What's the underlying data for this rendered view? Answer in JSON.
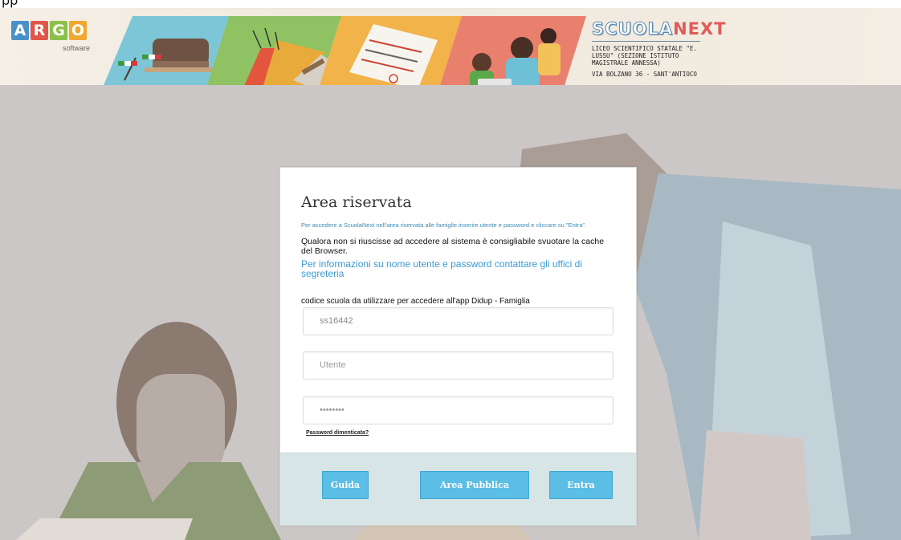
{
  "top_cut_text": "pp",
  "header": {
    "logo_letters": [
      {
        "char": "A",
        "color": "#4a90c8"
      },
      {
        "char": "R",
        "color": "#e0564a"
      },
      {
        "char": "G",
        "color": "#8cc04a"
      },
      {
        "char": "O",
        "color": "#f0a830"
      }
    ],
    "logo_sub": "software",
    "brand_part1": "SCUOLA",
    "brand_part2": "NEXT",
    "institute": "LICEO SCIENTIFICO STATALE \"E. LUSSU\" (SEZIONE ISTITUTO MAGISTRALE ANNESSA)",
    "address": "VIA BOLZANO 36 - SANT'ANTIOCO"
  },
  "login": {
    "title": "Area riservata",
    "intro": "Per accedere a ScuolaNext nell'area riservata alle famiglie inserire utente e password e cliccare su \"Entra\".",
    "cache_note": "Qualora non si riuscisse ad accedere al sistema è consigliabile svuotare la cache del Browser.",
    "info_link": "Per informazioni su nome utente e password contattare gli uffici di segreteria",
    "code_label": "codice scuola da utilizzare per accedere all'app Didup - Famiglia",
    "school_code_value": "ss16442",
    "username_placeholder": "Utente",
    "password_placeholder": "••••••••",
    "forgot_label": "Password dimenticata?",
    "buttons": {
      "guide": "Guida",
      "public_area": "Area Pubblica",
      "enter": "Entra"
    }
  }
}
